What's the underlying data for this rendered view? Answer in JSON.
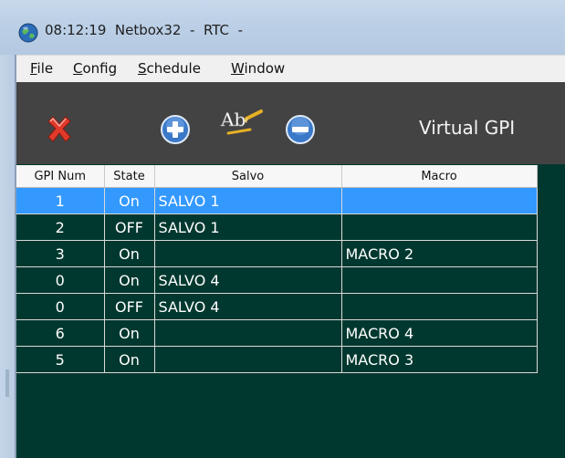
{
  "window": {
    "time": "08:12:19",
    "app_title": "Netbox32  -  RTC  -"
  },
  "menu": {
    "items": [
      {
        "u": "F",
        "rest": "ile"
      },
      {
        "u": "C",
        "rest": "onfig"
      },
      {
        "u": "S",
        "rest": "chedule"
      },
      {
        "u": "W",
        "rest": "indow"
      }
    ]
  },
  "toolbar": {
    "title": "Virtual GPI",
    "icons": [
      "delete-icon",
      "add-icon",
      "rename-icon",
      "remove-icon"
    ],
    "colors": {
      "delete": "#e23a2a",
      "add": "#3a78c8",
      "remove": "#3a78c8",
      "bg": "#434343"
    }
  },
  "table": {
    "headers": [
      "GPI Num",
      "State",
      "Salvo",
      "Macro"
    ],
    "rows": [
      {
        "num": "1",
        "state": "On",
        "salvo": "SALVO 1",
        "macro": "",
        "selected": true
      },
      {
        "num": "2",
        "state": "OFF",
        "salvo": "SALVO 1",
        "macro": ""
      },
      {
        "num": "3",
        "state": "On",
        "salvo": "",
        "macro": "MACRO 2"
      },
      {
        "num": "0",
        "state": "On",
        "salvo": "SALVO 4",
        "macro": ""
      },
      {
        "num": "0",
        "state": "OFF",
        "salvo": "SALVO 4",
        "macro": ""
      },
      {
        "num": "6",
        "state": "On",
        "salvo": "",
        "macro": "MACRO 4"
      },
      {
        "num": "5",
        "state": "On",
        "salvo": "",
        "macro": "MACRO 3"
      }
    ],
    "colors": {
      "grid_bg": "#00382f",
      "selected": "#3399ff"
    }
  }
}
